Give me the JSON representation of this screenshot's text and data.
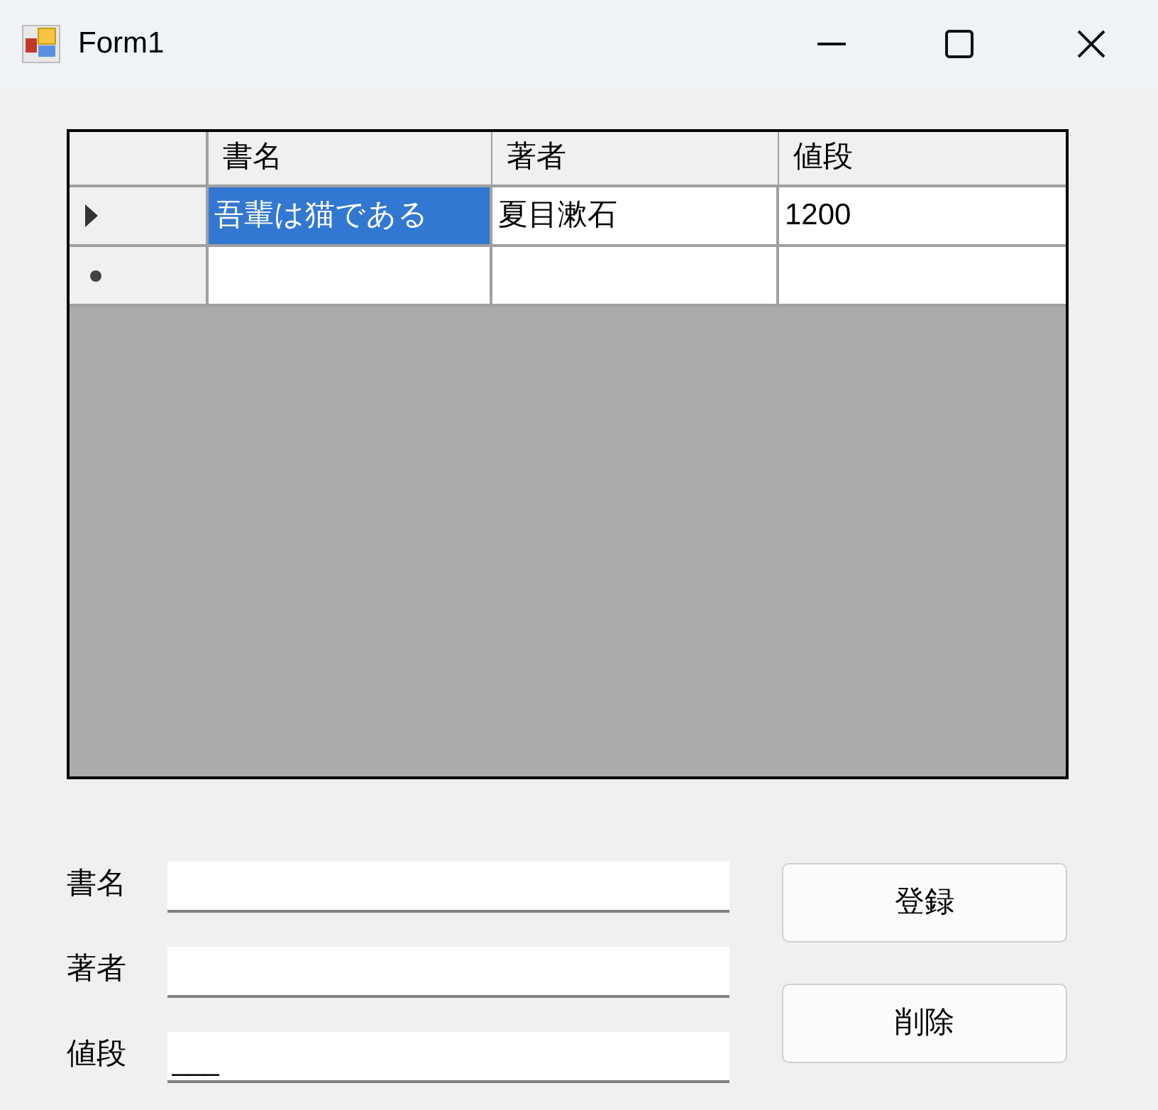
{
  "window": {
    "title": "Form1"
  },
  "grid": {
    "columns": [
      "書名",
      "著者",
      "値段"
    ],
    "rows": [
      {
        "kind": "current",
        "cells": [
          {
            "text": "吾輩は猫である",
            "selected": true
          },
          {
            "text": "夏目漱石",
            "selected": false
          },
          {
            "text": "1200",
            "selected": false
          }
        ]
      },
      {
        "kind": "new",
        "cells": [
          {
            "selected": false
          },
          {
            "selected": false
          },
          {
            "selected": false
          }
        ]
      }
    ]
  },
  "fields": [
    {
      "label": "書名"
    },
    {
      "label": "著者"
    },
    {
      "label": "値段",
      "value": "___"
    }
  ],
  "buttons": [
    "登録",
    "削除"
  ]
}
